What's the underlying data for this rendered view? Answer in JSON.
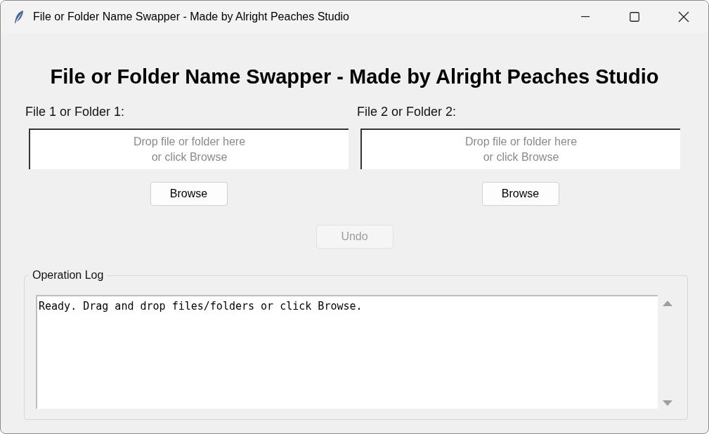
{
  "window": {
    "title": "File or Folder Name Swapper - Made by Alright Peaches Studio"
  },
  "heading": "File or Folder Name Swapper - Made by Alright Peaches Studio",
  "drop_zones": [
    {
      "label": "File 1 or Folder 1:",
      "placeholder": "Drop file or folder here\nor click Browse",
      "button": "Browse"
    },
    {
      "label": "File 2 or Folder 2:",
      "placeholder": "Drop file or folder here\nor click Browse",
      "button": "Browse"
    }
  ],
  "undo": {
    "label": "Undo",
    "disabled": true
  },
  "log": {
    "title": "Operation Log",
    "text": "Ready. Drag and drop files/folders or click Browse."
  }
}
